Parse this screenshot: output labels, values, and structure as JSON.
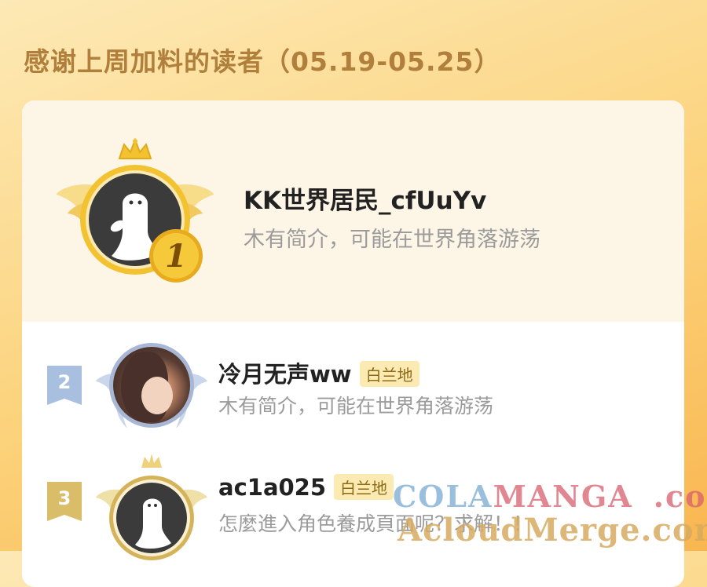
{
  "title": "感谢上周加料的读者（05.19-05.25）",
  "ranking": [
    {
      "rank": "1",
      "name": "KK世界居民_cfUuYv",
      "bio": "木有简介，可能在世界角落游荡"
    },
    {
      "rank": "2",
      "name": "冷月无声ww",
      "tag": "白兰地",
      "bio": "木有简介，可能在世界角落游荡"
    },
    {
      "rank": "3",
      "name": "ac1a025",
      "tag": "白兰地",
      "bio": "怎麼進入角色養成頁面呢？求解！！"
    }
  ],
  "watermark": {
    "line1_part1": "COLA",
    "line1_part2": "MANGA",
    "line1_part3": ".com",
    "line2": "AcloudMerge.com"
  },
  "colors": {
    "background_top": "#fde9b6",
    "background_bottom": "#f9b650",
    "title": "#b07f3c",
    "gold": "#f2c230",
    "silver_blue": "#a8b7d6",
    "bronze": "#d4b35a"
  }
}
